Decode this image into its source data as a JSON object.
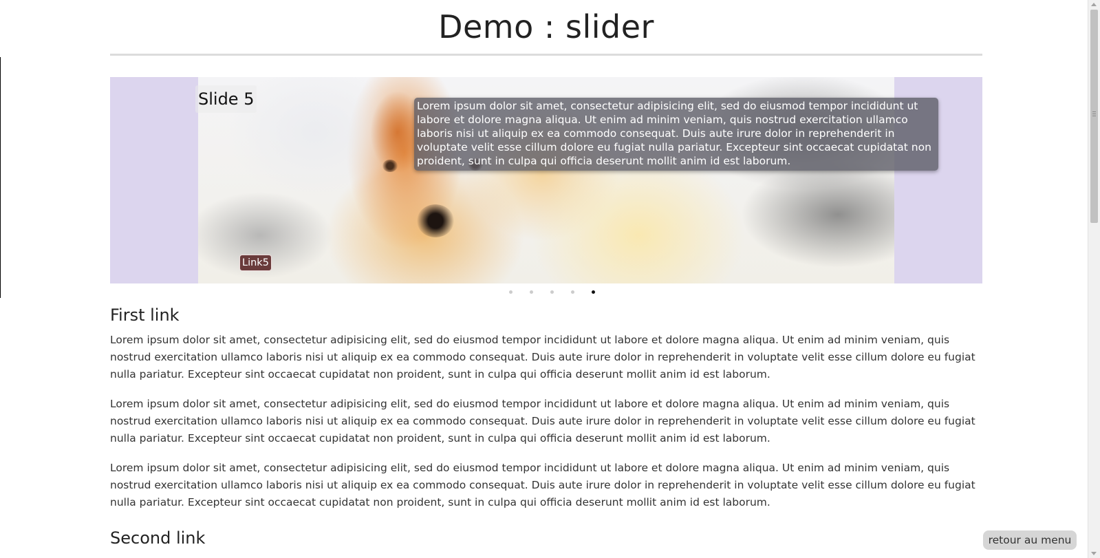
{
  "header": {
    "title": "Demo : slider"
  },
  "slider": {
    "current_slide": {
      "title": "Slide 5",
      "caption": "Lorem ipsum dolor sit amet, consectetur adipisicing elit, sed do eiusmod tempor incididunt ut labore et dolore magna aliqua. Ut enim ad minim veniam, quis nostrud exercitation ullamco laboris nisi ut aliquip ex ea commodo consequat. Duis aute irure dolor in reprehenderit in voluptate velit esse cillum dolore eu fugiat nulla pariatur. Excepteur sint occaecat cupidatat non proident, sunt in culpa qui officia deserunt mollit anim id est laborum.",
      "link_label": "Link5"
    },
    "slide_count": 5,
    "active_index": 5,
    "background_color": "#dcd5ee"
  },
  "sections": [
    {
      "heading": "First link",
      "paragraphs": [
        "Lorem ipsum dolor sit amet, consectetur adipisicing elit, sed do eiusmod tempor incididunt ut labore et dolore magna aliqua. Ut enim ad minim veniam, quis nostrud exercitation ullamco laboris nisi ut aliquip ex ea commodo consequat. Duis aute irure dolor in reprehenderit in voluptate velit esse cillum dolore eu fugiat nulla pariatur. Excepteur sint occaecat cupidatat non proident, sunt in culpa qui officia deserunt mollit anim id est laborum.",
        "Lorem ipsum dolor sit amet, consectetur adipisicing elit, sed do eiusmod tempor incididunt ut labore et dolore magna aliqua. Ut enim ad minim veniam, quis nostrud exercitation ullamco laboris nisi ut aliquip ex ea commodo consequat. Duis aute irure dolor in reprehenderit in voluptate velit esse cillum dolore eu fugiat nulla pariatur. Excepteur sint occaecat cupidatat non proident, sunt in culpa qui officia deserunt mollit anim id est laborum.",
        "Lorem ipsum dolor sit amet, consectetur adipisicing elit, sed do eiusmod tempor incididunt ut labore et dolore magna aliqua. Ut enim ad minim veniam, quis nostrud exercitation ullamco laboris nisi ut aliquip ex ea commodo consequat. Duis aute irure dolor in reprehenderit in voluptate velit esse cillum dolore eu fugiat nulla pariatur. Excepteur sint occaecat cupidatat non proident, sunt in culpa qui officia deserunt mollit anim id est laborum."
      ]
    },
    {
      "heading": "Second link"
    }
  ],
  "back_button": {
    "label": "retour au menu"
  },
  "icons": {
    "scroll_up": "scroll-up-arrow-icon",
    "scroll_down": "scroll-down-arrow-icon"
  }
}
